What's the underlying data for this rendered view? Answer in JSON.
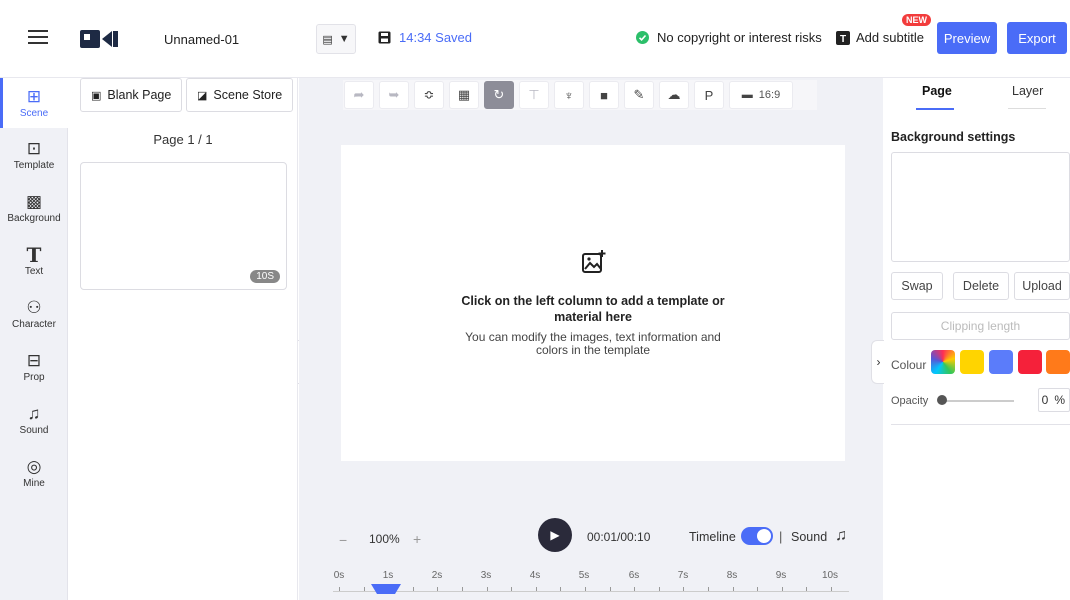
{
  "header": {
    "project_title": "Unnamed-01",
    "save_time": "14:34 Saved",
    "copyright_text": "No copyright or interest risks",
    "add_subtitle": "Add subtitle",
    "new_badge": "NEW",
    "preview_label": "Preview",
    "export_label": "Export"
  },
  "nav": {
    "items": [
      {
        "label": "Scene",
        "icon": "scene-icon"
      },
      {
        "label": "Template",
        "icon": "template-icon"
      },
      {
        "label": "Background",
        "icon": "background-icon"
      },
      {
        "label": "Text",
        "icon": "text-icon"
      },
      {
        "label": "Character",
        "icon": "character-icon"
      },
      {
        "label": "Prop",
        "icon": "prop-icon"
      },
      {
        "label": "Sound",
        "icon": "sound-icon"
      },
      {
        "label": "Mine",
        "icon": "mine-icon"
      }
    ]
  },
  "scene_panel": {
    "blank_page": "Blank Page",
    "scene_store": "Scene Store",
    "page_count": "Page 1 / 1",
    "thumb_duration": "10S"
  },
  "toolbar": {
    "aspect_ratio": "16:9"
  },
  "canvas": {
    "heading": "Click on the left column to add a template or material here",
    "subtext": "You can modify the images, text information and colors in the template"
  },
  "playbar": {
    "zoom": "100%",
    "time": "00:01/00:10",
    "timeline_label": "Timeline",
    "separator": "|",
    "sound_label": "Sound"
  },
  "ruler": {
    "labels": [
      "0s",
      "1s",
      "2s",
      "3s",
      "4s",
      "5s",
      "6s",
      "7s",
      "8s",
      "9s",
      "10s"
    ]
  },
  "right_panel": {
    "tab_page": "Page",
    "tab_layer": "Layer",
    "bg_settings": "Background settings",
    "swap": "Swap",
    "delete": "Delete",
    "upload": "Upload",
    "clipping": "Clipping length",
    "colour_label": "Colour",
    "opacity_label": "Opacity",
    "opacity_value": "0",
    "opacity_unit": "%",
    "swatches": [
      "#ffd400",
      "#5b7cfa",
      "#f5213a",
      "#ff7a1a"
    ]
  },
  "colors": {
    "accent": "#4a6cf7",
    "success": "#2cbf6a",
    "danger": "#f23c3c"
  }
}
